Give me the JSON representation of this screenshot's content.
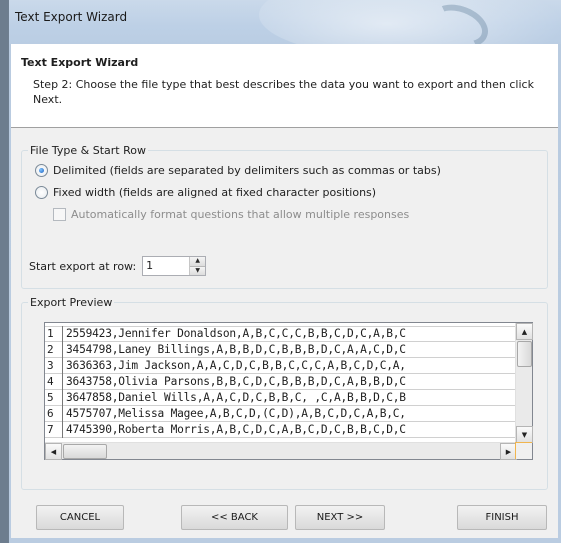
{
  "window": {
    "title": "Text Export Wizard"
  },
  "header": {
    "title": "Text Export Wizard",
    "description": "Step 2: Choose the file type that best describes the data you want to export and then click Next."
  },
  "file_type_group": {
    "legend": "File Type & Start Row",
    "options": [
      {
        "label": "Delimited (fields are separated by delimiters such as commas or tabs)",
        "checked": true
      },
      {
        "label": "Fixed width (fields are aligned at fixed character positions)",
        "checked": false
      }
    ],
    "auto_format_label": "Automatically format questions that allow multiple responses",
    "auto_format_checked": false,
    "start_row_label": "Start export at row:",
    "start_row_value": "1"
  },
  "preview_group": {
    "legend": "Export Preview",
    "rows": [
      {
        "num": "1",
        "text": "2559423,Jennifer Donaldson,A,B,C,C,C,B,B,C,D,C,A,B,C"
      },
      {
        "num": "2",
        "text": "3454798,Laney Billings,A,B,B,D,C,B,B,B,D,C,A,A,C,D,C"
      },
      {
        "num": "3",
        "text": "3636363,Jim Jackson,A,A,C,D,C,B,B,C,C,C,A,B,C,D,C,A,"
      },
      {
        "num": "4",
        "text": "3643758,Olivia Parsons,B,B,C,D,C,B,B,B,D,C,A,B,B,D,C"
      },
      {
        "num": "5",
        "text": "3647858,Daniel Wills,A,A,C,D,C,B,B,C, ,C,A,B,B,D,C,B"
      },
      {
        "num": "6",
        "text": "4575707,Melissa Magee,A,B,C,D,(C,D),A,B,C,D,C,A,B,C,"
      },
      {
        "num": "7",
        "text": "4745390,Roberta Morris,A,B,C,D,C,A,B,C,D,C,B,B,C,D,C"
      }
    ]
  },
  "buttons": {
    "cancel": "CANCEL",
    "back": "<< BACK",
    "next": "NEXT >>",
    "finish": "FINISH"
  }
}
